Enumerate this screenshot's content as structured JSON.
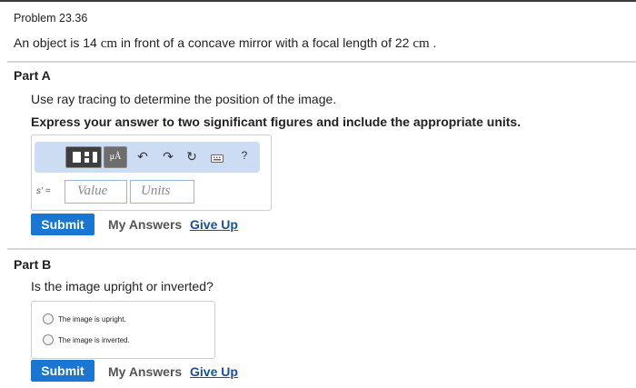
{
  "problem": {
    "title": "Problem 23.36",
    "text_part1": "An object is 14 ",
    "unit1": "cm",
    "text_part2": " in front of a concave mirror with a focal length of 22 ",
    "unit2": "cm",
    "text_part3": " ."
  },
  "part_a": {
    "heading": "Part A",
    "instruction": "Use ray tracing to determine the position of the image.",
    "instruction_bold": "Express your answer to two significant figures and include the appropriate units.",
    "toolbar": {
      "units_button_label": "μÅ",
      "help_label": "?"
    },
    "variable_label": "s' =",
    "value_placeholder": "Value",
    "units_placeholder": "Units",
    "submit_label": "Submit",
    "my_answers_label": "My Answers",
    "give_up_label": "Give Up"
  },
  "part_b": {
    "heading": "Part B",
    "question": "Is the image upright or inverted?",
    "choices": [
      "The image is upright.",
      "The image is inverted."
    ],
    "submit_label": "Submit",
    "my_answers_label": "My Answers",
    "give_up_label": "Give Up"
  },
  "colors": {
    "submit": "#1976d2",
    "link": "#1a4fa0",
    "toolbar": "#cbdcf3"
  }
}
